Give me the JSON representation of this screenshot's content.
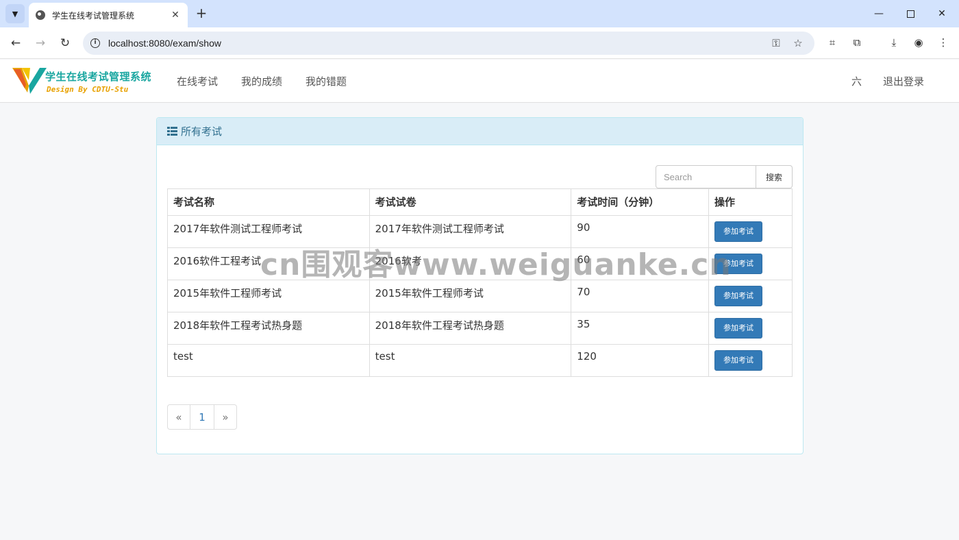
{
  "browser": {
    "tab_title": "学生在线考试管理系统",
    "url": "localhost:8080/exam/show",
    "new_tab_symbol": "+",
    "close_symbol": "✕"
  },
  "app": {
    "logo_title": "学生在线考试管理系统",
    "logo_subtitle": "Design By CDTU-Stu",
    "nav": [
      "在线考试",
      "我的成绩",
      "我的错题"
    ],
    "user_name": "六",
    "logout_label": "退出登录"
  },
  "panel": {
    "title": "所有考试",
    "search_placeholder": "Search",
    "search_button": "搜索",
    "columns": [
      "考试名称",
      "考试试卷",
      "考试时间（分钟）",
      "操作"
    ],
    "rows": [
      {
        "name": "2017年软件测试工程师考试",
        "paper": "2017年软件测试工程师考试",
        "time": "90",
        "action": "参加考试"
      },
      {
        "name": "2016软件工程考试",
        "paper": "2016软考",
        "time": "60",
        "action": "参加考试"
      },
      {
        "name": "2015年软件工程师考试",
        "paper": "2015年软件工程师考试",
        "time": "70",
        "action": "参加考试"
      },
      {
        "name": "2018年软件工程考试热身题",
        "paper": "2018年软件工程考试热身题",
        "time": "35",
        "action": "参加考试"
      },
      {
        "name": "test",
        "paper": "test",
        "time": "120",
        "action": "参加考试"
      }
    ],
    "pagination": {
      "prev": "«",
      "current": "1",
      "next": "»"
    }
  },
  "watermark": "cn围观客www.weiguanke.cn",
  "colors": {
    "primary": "#337ab7",
    "panel_heading_bg": "#d9edf7",
    "panel_heading_text": "#31708f",
    "logo_teal": "#19a6a0",
    "logo_orange": "#e8a100"
  }
}
